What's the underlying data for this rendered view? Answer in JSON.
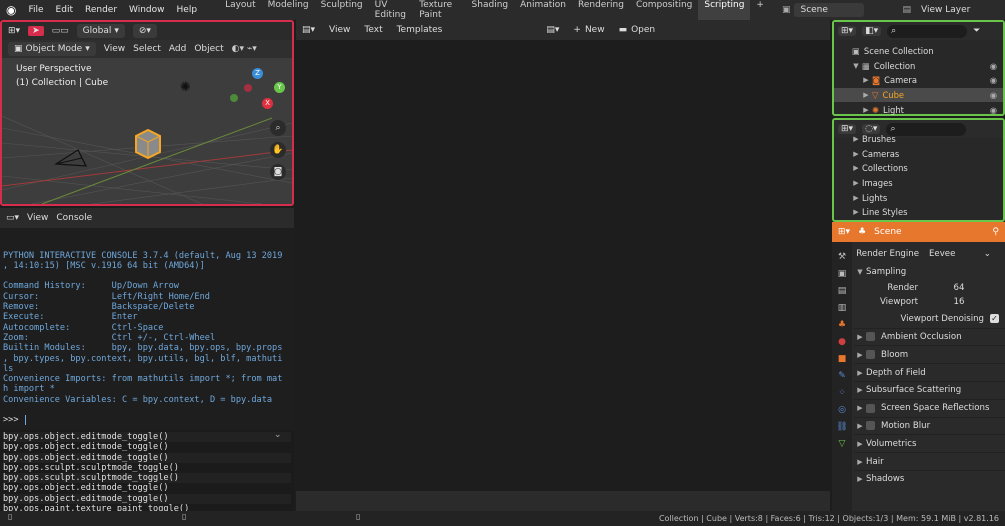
{
  "topbar": {
    "menus": [
      "File",
      "Edit",
      "Render",
      "Window",
      "Help"
    ],
    "workspaces": [
      "Layout",
      "Modeling",
      "Sculpting",
      "UV Editing",
      "Texture Paint",
      "Shading",
      "Animation",
      "Rendering",
      "Compositing",
      "Scripting"
    ],
    "active_workspace": "Scripting",
    "add": "+",
    "scene": "Scene",
    "view_layer": "View Layer"
  },
  "viewport": {
    "orientation": "Global",
    "mode": "Object Mode",
    "menus": [
      "View",
      "Select",
      "Add",
      "Object"
    ],
    "perspective": "User Perspective",
    "collection_info": "(1) Collection | Cube",
    "axes": {
      "x": "X",
      "y": "Y",
      "z": "Z"
    }
  },
  "console": {
    "menus": [
      "View",
      "Console"
    ],
    "lines": [
      "",
      "",
      "PYTHON INTERACTIVE CONSOLE 3.7.4 (default, Aug 13 2019",
      ", 14:10:15) [MSC v.1916 64 bit (AMD64)]",
      "",
      "Command History:     Up/Down Arrow",
      "Cursor:              Left/Right Home/End",
      "Remove:              Backspace/Delete",
      "Execute:             Enter",
      "Autocomplete:        Ctrl-Space",
      "Zoom:                Ctrl +/-, Ctrl-Wheel",
      "Builtin Modules:     bpy, bpy.data, bpy.ops, bpy.props",
      ", bpy.types, bpy.context, bpy.utils, bgl, blf, mathuti",
      "ls",
      "Convenience Imports: from mathutils import *; from mat",
      "h import *",
      "Convenience Variables: C = bpy.context, D = bpy.data"
    ],
    "prompt": ">>> "
  },
  "info_log": [
    "bpy.ops.object.editmode_toggle()",
    "bpy.ops.object.editmode_toggle()",
    "bpy.ops.object.editmode_toggle()",
    "bpy.ops.sculpt.sculptmode_toggle()",
    "bpy.ops.sculpt.sculptmode_toggle()",
    "bpy.ops.object.editmode_toggle()",
    "bpy.ops.object.editmode_toggle()",
    "bpy.ops.paint.texture_paint_toggle()"
  ],
  "text_editor": {
    "menus": [
      "View",
      "Text",
      "Templates"
    ],
    "new": "New",
    "open": "Open"
  },
  "outliner": {
    "rows": [
      {
        "label": "Scene Collection",
        "indent": 0
      },
      {
        "label": "Collection",
        "indent": 1
      },
      {
        "label": "Camera",
        "indent": 2
      },
      {
        "label": "Cube",
        "indent": 2,
        "selected": true
      },
      {
        "label": "Light",
        "indent": 2
      }
    ]
  },
  "datablocks": {
    "rows": [
      "Brushes",
      "Cameras",
      "Collections",
      "Images",
      "Lights",
      "Line Styles"
    ]
  },
  "properties": {
    "tab": "Scene",
    "render_engine_label": "Render Engine",
    "render_engine": "Eevee",
    "sampling": "Sampling",
    "render_label": "Render",
    "render_value": "64",
    "viewport_label": "Viewport",
    "viewport_value": "16",
    "denoise": "Viewport Denoising",
    "panels": [
      "Ambient Occlusion",
      "Bloom",
      "Depth of Field",
      "Subsurface Scattering",
      "Screen Space Reflections",
      "Motion Blur",
      "Volumetrics",
      "Hair",
      "Shadows"
    ]
  },
  "statusbar": "Collection | Cube | Verts:8 | Faces:6 | Tris:12 | Objects:1/3 | Mem: 59.1 MiB | v2.81.16",
  "colors": {
    "accent": "#e8772e",
    "selection": "#f5a623",
    "red_editor": "#d62d4c",
    "green_editor": "#6ac64b"
  }
}
